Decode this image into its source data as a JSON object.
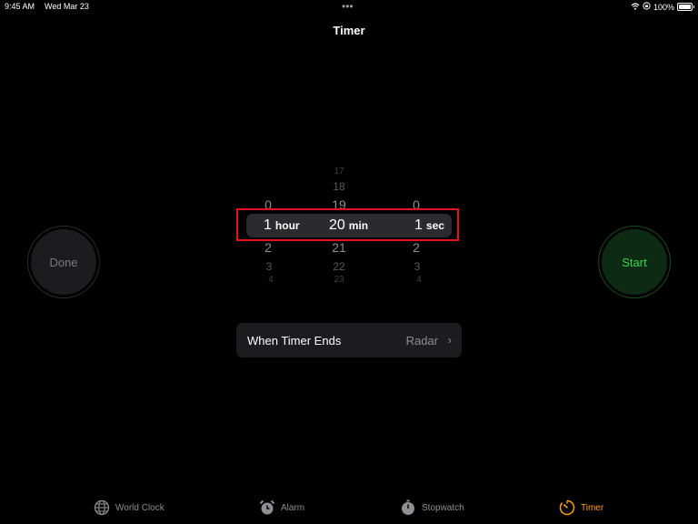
{
  "status_bar": {
    "time": "9:45 AM",
    "date": "Wed Mar 23",
    "dots": "•••",
    "battery": "100%"
  },
  "header": {
    "title": "Timer"
  },
  "picker": {
    "hours": {
      "above": [
        "0"
      ],
      "selected": "1",
      "below": [
        "2",
        "3",
        "4"
      ],
      "unit": "hour"
    },
    "minutes": {
      "above": [
        "17",
        "18",
        "19"
      ],
      "selected": "20",
      "below": [
        "21",
        "22",
        "23"
      ],
      "unit": "min"
    },
    "seconds": {
      "above": [
        "0"
      ],
      "selected": "1",
      "below": [
        "2",
        "3",
        "4"
      ],
      "unit": "sec"
    }
  },
  "buttons": {
    "done": "Done",
    "start": "Start"
  },
  "when_timer_ends": {
    "label": "When Timer Ends",
    "value": "Radar",
    "chevron": "›"
  },
  "tabs": [
    {
      "label": "World Clock",
      "icon": "globe-icon"
    },
    {
      "label": "Alarm",
      "icon": "alarm-clock-icon"
    },
    {
      "label": "Stopwatch",
      "icon": "stopwatch-icon"
    },
    {
      "label": "Timer",
      "icon": "timer-icon",
      "active": true
    }
  ],
  "colors": {
    "accent": "#ff9f0a",
    "start_green": "#32d74b",
    "highlight_red": "#e8111b"
  }
}
